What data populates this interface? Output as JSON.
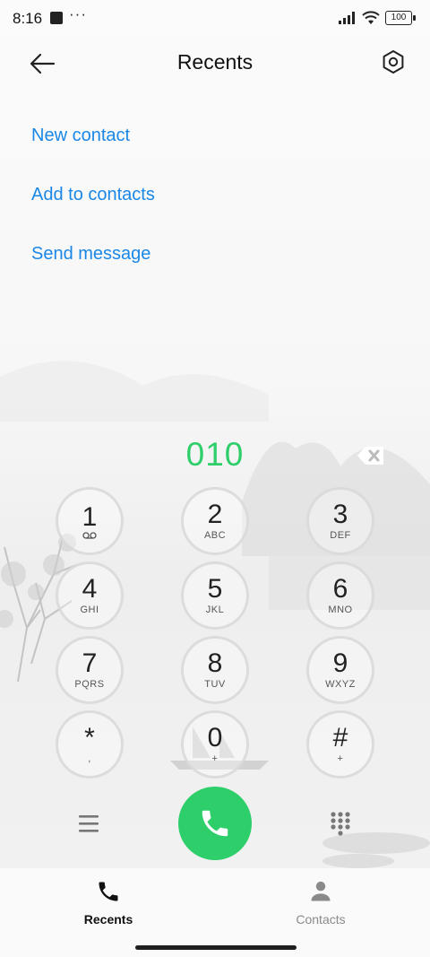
{
  "status_bar": {
    "time": "8:16",
    "dots": "···",
    "battery": "100"
  },
  "header": {
    "title": "Recents"
  },
  "actions": [
    {
      "label": "New contact"
    },
    {
      "label": "Add to contacts"
    },
    {
      "label": "Send message"
    }
  ],
  "dialer": {
    "number": "010",
    "keys": [
      {
        "digit": "1",
        "letters": ""
      },
      {
        "digit": "2",
        "letters": "ABC"
      },
      {
        "digit": "3",
        "letters": "DEF"
      },
      {
        "digit": "4",
        "letters": "GHI"
      },
      {
        "digit": "5",
        "letters": "JKL"
      },
      {
        "digit": "6",
        "letters": "MNO"
      },
      {
        "digit": "7",
        "letters": "PQRS"
      },
      {
        "digit": "8",
        "letters": "TUV"
      },
      {
        "digit": "9",
        "letters": "WXYZ"
      },
      {
        "digit": "*",
        "letters": ","
      },
      {
        "digit": "0",
        "letters": "+"
      },
      {
        "digit": "#",
        "letters": "+"
      }
    ]
  },
  "bottom_nav": {
    "recents_label": "Recents",
    "contacts_label": "Contacts"
  },
  "colors": {
    "accent_blue": "#1a87e6",
    "call_green": "#2ecf6a"
  }
}
